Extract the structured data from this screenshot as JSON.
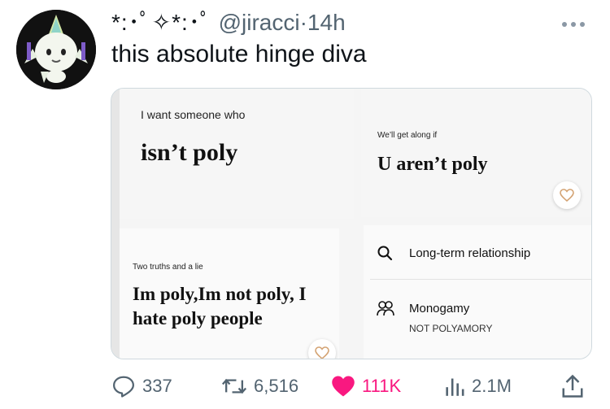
{
  "tweet": {
    "display_name": "*:･ﾟ✧*:･ﾟ",
    "handle": "@jiracci",
    "separator": "·",
    "time": "14h",
    "text": "this absolute hinge diva",
    "more_icon": "more-horizontal-icon"
  },
  "profile": {
    "prompt1": {
      "question": "I want someone who",
      "answer": "isn’t poly"
    },
    "prompt2": {
      "question": "We’ll get along if",
      "answer": "U aren’t poly"
    },
    "prompt3": {
      "question": "Two truths and a lie",
      "answer_line1": "Im poly,Im not poly, I",
      "answer_line2": "hate poly people"
    },
    "traits": [
      {
        "icon": "search-icon",
        "label": "Long-term relationship"
      },
      {
        "icon": "people-icon",
        "label": "Monogamy",
        "sub": "NOT POLYAMORY"
      }
    ]
  },
  "actions": {
    "replies": "337",
    "retweets": "6,516",
    "likes": "111K",
    "views": "2.1M",
    "colors": {
      "muted": "#536471",
      "like": "#f91880"
    }
  }
}
